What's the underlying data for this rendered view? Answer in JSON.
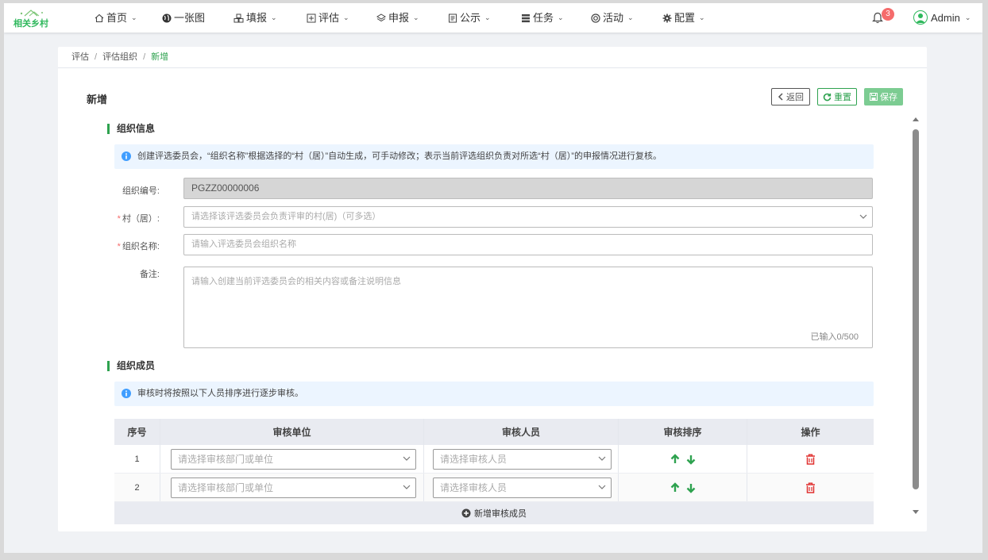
{
  "brand": {
    "logo_text": "相关乡村"
  },
  "nav": {
    "items": [
      {
        "label": "首页",
        "icon": "home-icon",
        "has_dropdown": true
      },
      {
        "label": "一张图",
        "icon": "globe-icon",
        "has_dropdown": false
      },
      {
        "label": "填报",
        "icon": "cubes-icon",
        "has_dropdown": true
      },
      {
        "label": "评估",
        "icon": "evaluate-icon",
        "has_dropdown": true
      },
      {
        "label": "申报",
        "icon": "layers-icon",
        "has_dropdown": true
      },
      {
        "label": "公示",
        "icon": "notice-board-icon",
        "has_dropdown": true
      },
      {
        "label": "任务",
        "icon": "tasks-icon",
        "has_dropdown": true
      },
      {
        "label": "活动",
        "icon": "lifebuoy-icon",
        "has_dropdown": true
      },
      {
        "label": "配置",
        "icon": "gear-icon",
        "has_dropdown": true
      }
    ],
    "notifications_count": "3",
    "user_name": "Admin"
  },
  "breadcrumb": {
    "items": [
      "评估",
      "评估组织"
    ],
    "current": "新增",
    "separator": "/"
  },
  "page": {
    "title": "新增"
  },
  "actions": {
    "back_label": "返回",
    "reset_label": "重置",
    "save_label": "保存"
  },
  "org_info": {
    "section_title": "组织信息",
    "notice": "创建评选委员会，“组织名称”根据选择的“村（居）”自动生成，可手动修改；表示当前评选组织负责对所选“村（居）”的申报情况进行复核。",
    "fields": {
      "code": {
        "label": "组织编号:",
        "value": "PGZZ00000006"
      },
      "village": {
        "label": "村（居）:",
        "required": true,
        "placeholder": "请选择该评选委员会负责评审的村(居)（可多选）"
      },
      "name": {
        "label": "组织名称:",
        "required": true,
        "placeholder": "请输入评选委员会组织名称"
      },
      "remark": {
        "label": "备注:",
        "placeholder": "请输入创建当前评选委员会的相关内容或备注说明信息",
        "counter": "已输入0/500"
      }
    }
  },
  "members": {
    "section_title": "组织成员",
    "notice": "审核时将按照以下人员排序进行逐步审核。",
    "columns": [
      "序号",
      "审核单位",
      "审核人员",
      "审核排序",
      "操作"
    ],
    "rows": [
      {
        "index": "1",
        "unit_placeholder": "请选择审核部门或单位",
        "person_placeholder": "请选择审核人员"
      },
      {
        "index": "2",
        "unit_placeholder": "请选择审核部门或单位",
        "person_placeholder": "请选择审核人员"
      }
    ],
    "add_label": "新增审核成员"
  },
  "colors": {
    "accent": "#2ea24f",
    "danger": "#e0302f",
    "notice_bg": "#ecf5ff",
    "info": "#409eff"
  }
}
